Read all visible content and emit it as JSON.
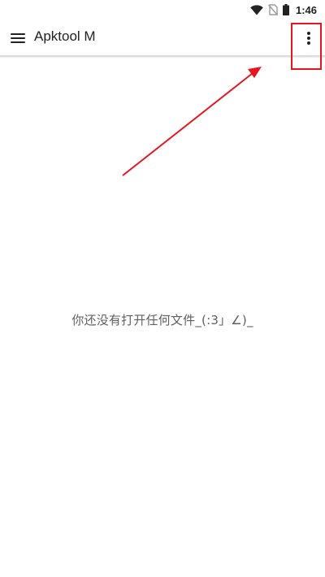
{
  "status_bar": {
    "time": "1:46",
    "icons": [
      "wifi-icon",
      "no-sim-icon",
      "battery-icon"
    ]
  },
  "app_bar": {
    "title": "Apktool M",
    "menu_icon": "hamburger-menu-icon",
    "overflow_icon": "more-vert-icon"
  },
  "main": {
    "empty_message": "你还没有打开任何文件_(:3」∠)_"
  },
  "annotation": {
    "color": "#e8141e"
  }
}
